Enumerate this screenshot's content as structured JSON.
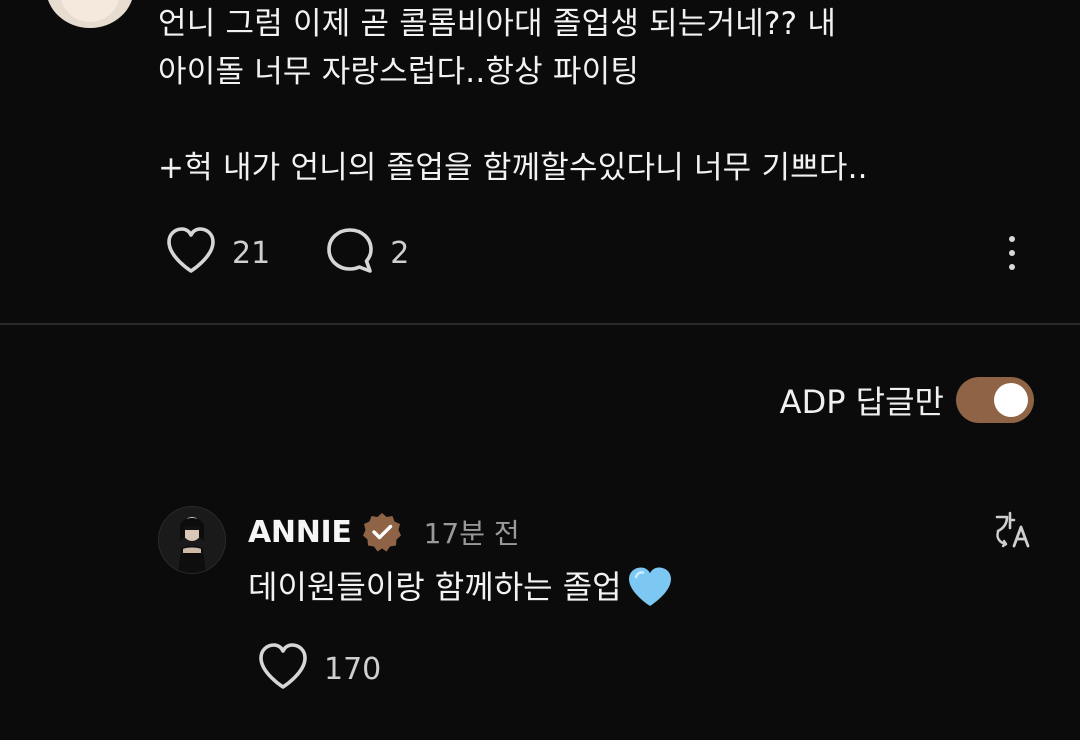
{
  "post": {
    "text": "언니 그럼 이제 곧 콜롬비아대 졸업생 되는거네?? 내\n아이돌 너무 자랑스럽다..항상 파이팅\n\n+헉 내가 언니의 졸업을 함께할수있다니 너무 기쁘다..",
    "like_count": "21",
    "reply_count": "2"
  },
  "filter": {
    "label": "ADP 답글만",
    "enabled": true
  },
  "reply": {
    "author": "ANNIE",
    "time": "17분 전",
    "text": "데이원들이랑 함께하는 졸업",
    "emoji": "light-blue-heart",
    "like_count": "170"
  },
  "colors": {
    "background": "#0b0b0b",
    "toggle_on": "#8f6446",
    "verified_badge": "#8f6446",
    "heart_emoji": "#7cc8f2"
  },
  "icons": {
    "like": "heart-outline-icon",
    "reply": "speech-bubble-icon",
    "more": "more-vertical-icon",
    "translate": "translate-icon",
    "verified": "verified-badge-icon"
  }
}
